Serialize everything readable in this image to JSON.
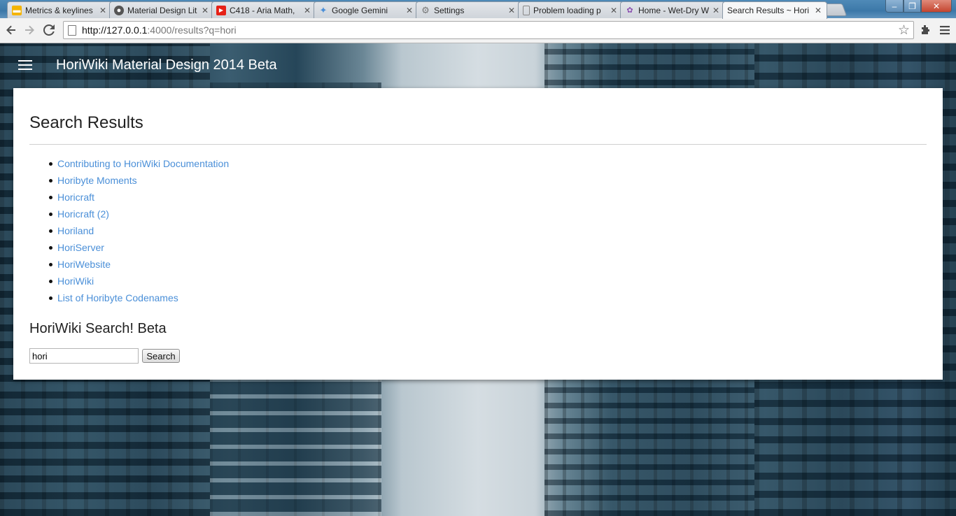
{
  "browser": {
    "tabs": [
      {
        "title": "Metrics & keylines",
        "icon": "google-docs-icon",
        "color": "#f4b400"
      },
      {
        "title": "Material Design Lit",
        "icon": "github-icon",
        "color": "#555555"
      },
      {
        "title": "C418 - Aria Math,",
        "icon": "youtube-icon",
        "color": "#e62117"
      },
      {
        "title": "Google Gemini",
        "icon": "sparkle-icon",
        "color": "#4a8fd8"
      },
      {
        "title": "Settings",
        "icon": "gear-icon",
        "color": "#777777"
      },
      {
        "title": "Problem loading p",
        "icon": "page-icon",
        "color": "#777777"
      },
      {
        "title": "Home - Wet-Dry W",
        "icon": "site-icon",
        "color": "#8a4fb0"
      },
      {
        "title": "Search Results ~ Hori",
        "icon": "page-icon",
        "color": "#777777"
      }
    ],
    "url_host": "http://127.0.0.1",
    "url_rest": ":4000/results?q=hori"
  },
  "app": {
    "title": "HoriWiki Material Design 2014 Beta"
  },
  "results": {
    "heading": "Search Results",
    "items": [
      "Contributing to HoriWiki Documentation",
      "Horibyte Moments",
      "Horicraft",
      "Horicraft (2)",
      "Horiland",
      "HoriServer",
      "HoriWebsite",
      "HoriWiki",
      "List of Horibyte Codenames"
    ]
  },
  "search": {
    "heading": "HoriWiki Search! Beta",
    "value": "hori",
    "button": "Search"
  },
  "colors": {
    "link": "#4a8fd8",
    "card": "#ffffff"
  }
}
